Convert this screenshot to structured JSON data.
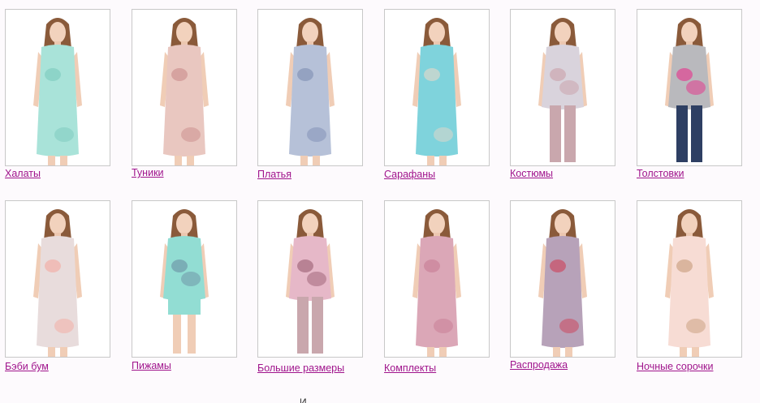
{
  "categories": [
    {
      "label": "Халаты",
      "dress_color": "#a9e3d9",
      "accent": "#7cc9bd",
      "legs": "none"
    },
    {
      "label": "Туники",
      "dress_color": "#e9c7c0",
      "accent": "#c98b8a",
      "legs": "none"
    },
    {
      "label": "Платья",
      "dress_color": "#b6c1d8",
      "accent": "#7d8db3",
      "legs": "none"
    },
    {
      "label": "Сарафаны",
      "dress_color": "#7fd3dc",
      "accent": "#e8d8c8",
      "legs": "none"
    },
    {
      "label": "Костюмы",
      "dress_color": "#d9d3dc",
      "accent": "#c9a0a8",
      "legs": "pants"
    },
    {
      "label": "Толстовки",
      "dress_color": "#b9b9bd",
      "accent": "#e8308a",
      "legs": "jeans"
    },
    {
      "label": "Бэби бум",
      "dress_color": "#e8dcdc",
      "accent": "#f3a9a0",
      "legs": "none"
    },
    {
      "label": "Пижамы",
      "dress_color": "#92ddd3",
      "accent": "#6b8fa3",
      "legs": "shorts"
    },
    {
      "label": "Большие размеры",
      "dress_color": "#e6b8c8",
      "accent": "#9a5e72",
      "legs": "pants"
    },
    {
      "label": "Комплекты",
      "dress_color": "#dba7b7",
      "accent": "#c77b94",
      "legs": "none"
    },
    {
      "label": "Распродажа",
      "dress_color": "#b7a2b9",
      "accent": "#cf3d56",
      "legs": "none"
    },
    {
      "label": "Ночные сорочки",
      "dress_color": "#f7dcd4",
      "accent": "#c79b7a",
      "legs": "none"
    }
  ],
  "footer_fragment": "И"
}
